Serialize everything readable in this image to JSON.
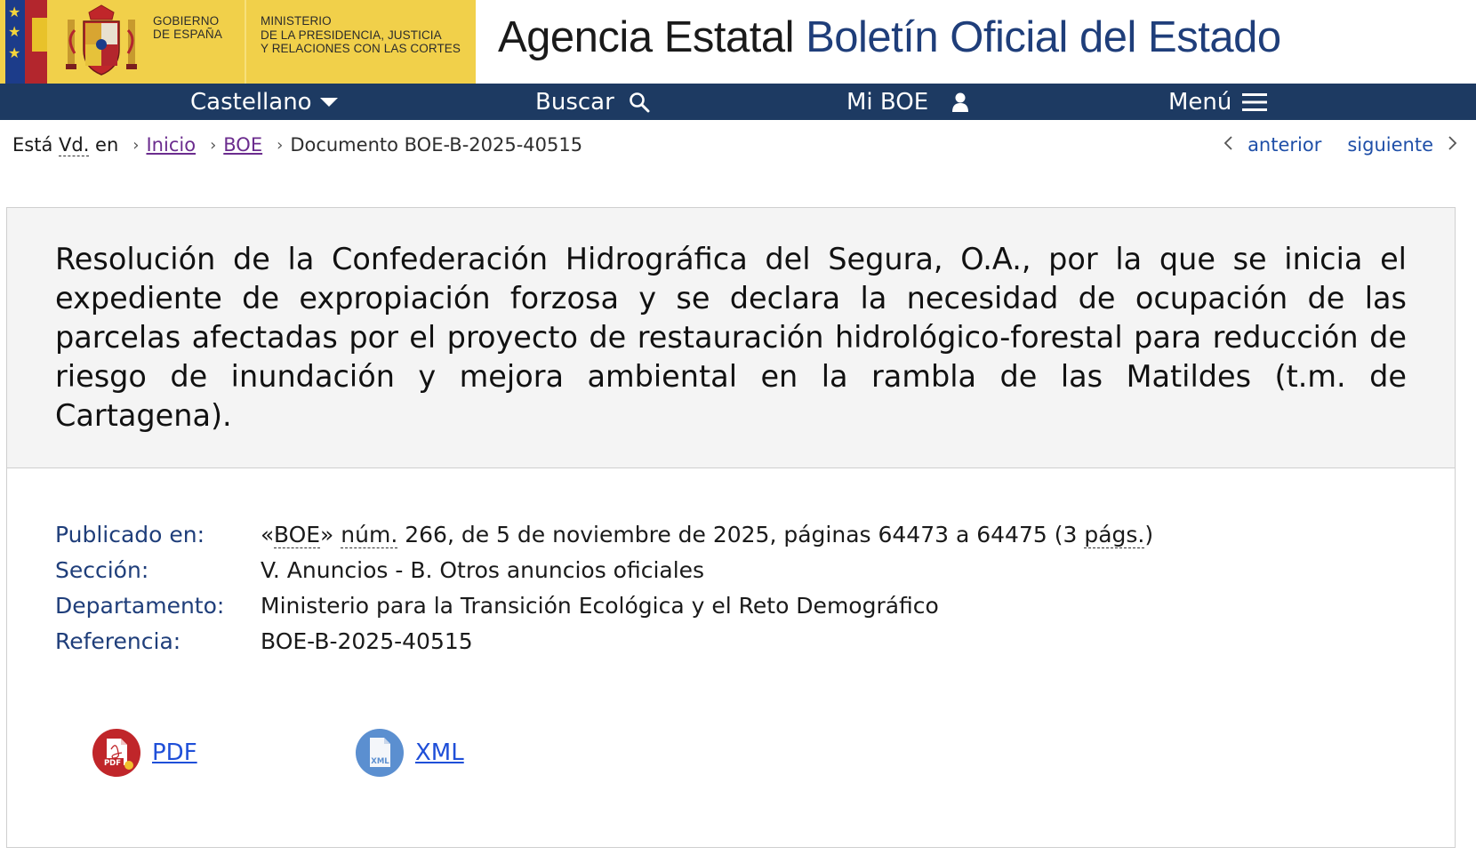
{
  "header": {
    "gov_line1": "Gobierno",
    "gov_line2": "de España",
    "ministry_line1": "Ministerio",
    "ministry_line2": "de la Presidencia, Justicia",
    "ministry_line3": "y Relaciones con las Cortes",
    "agency_prefix": "Agencia Estatal ",
    "agency_highlight": "Boletín Oficial del Estado"
  },
  "nav": {
    "items": [
      {
        "label": "Castellano",
        "icon": "caret-down-icon"
      },
      {
        "label": "Buscar",
        "icon": "search-icon"
      },
      {
        "label": "Mi BOE",
        "icon": "user-icon"
      },
      {
        "label": "Menú",
        "icon": "hamburger-icon"
      }
    ]
  },
  "breadcrumb": {
    "intro_before": "Está ",
    "intro_abbr": "Vd.",
    "intro_after": " en",
    "sep": "›",
    "items": [
      {
        "label": "Inicio"
      },
      {
        "label": "BOE"
      },
      {
        "label": "Documento BOE-B-2025-40515"
      }
    ]
  },
  "pager": {
    "prev": "anterior",
    "next": "siguiente"
  },
  "document": {
    "title": "Resolución de la Confederación Hidrográfica del Segura, O.A., por la que se inicia el expediente de expropiación forzosa y se declara la necesidad de ocupación de las parcelas afectadas por el proyecto de restauración hidrológico-forestal para reducción de riesgo de inundación y mejora ambiental en la rambla de las Matildes (t.m. de Cartagena).",
    "meta": {
      "publicado_label": "Publicado en:",
      "publicado_open": "«",
      "publicado_boe": "BOE",
      "publicado_close": "» ",
      "publicado_num": "núm.",
      "publicado_rest": " 266, de 5 de noviembre de 2025, páginas 64473 a 64475 (3 ",
      "publicado_pags": "págs.",
      "publicado_end": ")",
      "seccion_label": "Sección:",
      "seccion_value": "V. Anuncios - B. Otros anuncios oficiales",
      "departamento_label": "Departamento:",
      "departamento_value": "Ministerio para la Transición Ecológica y el Reto Demográfico",
      "referencia_label": "Referencia:",
      "referencia_value": "BOE-B-2025-40515"
    },
    "downloads": [
      {
        "label": "PDF",
        "icon": "pdf-icon",
        "icon_text": "PDF",
        "color": "#c0262a"
      },
      {
        "label": "XML",
        "icon": "xml-icon",
        "icon_text": "XML",
        "color": "#5b8fd0"
      }
    ]
  }
}
